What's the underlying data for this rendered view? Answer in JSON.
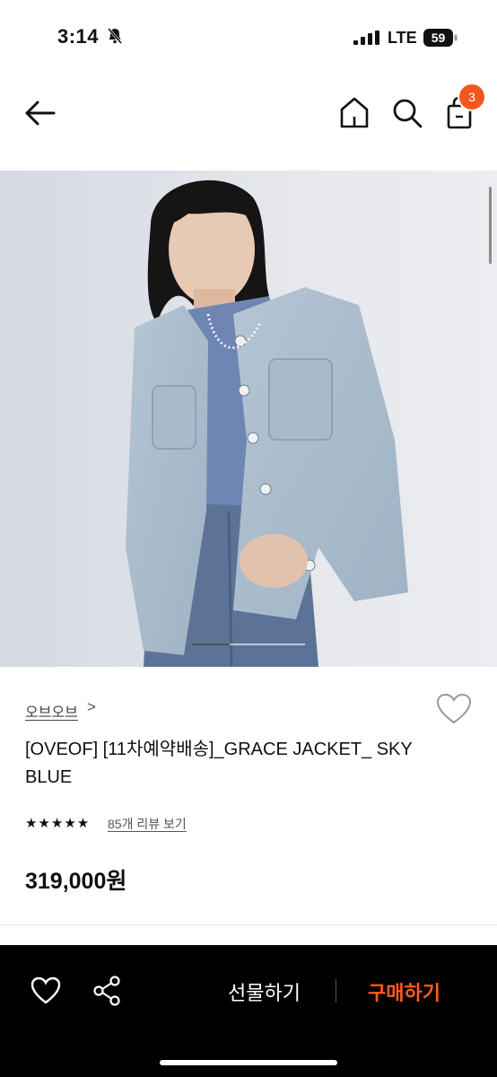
{
  "status_bar": {
    "time": "3:14",
    "network": "LTE",
    "battery": "59"
  },
  "nav": {
    "cart_count": "3"
  },
  "product": {
    "brand": "오브오브",
    "brand_chevron": ">",
    "title": "[OVEOF] [11차예약배송]_GRACE JACKET_ SKY BLUE",
    "rating_stars": "★★★★★",
    "rating": 5,
    "review_link": "85개 리뷰 보기",
    "price": "319,000원",
    "image_slide_progress": 0.33
  },
  "bottom_bar": {
    "gift_label": "선물하기",
    "buy_label": "구매하기"
  },
  "colors": {
    "accent": "#f2571d",
    "buy": "#ff5a1f",
    "bar_bg": "#000000"
  },
  "icons": [
    "bell-off-icon",
    "signal-icon",
    "battery-icon",
    "back-arrow-icon",
    "home-icon",
    "search-icon",
    "shopping-bag-icon",
    "heart-outline-icon",
    "share-icon"
  ]
}
